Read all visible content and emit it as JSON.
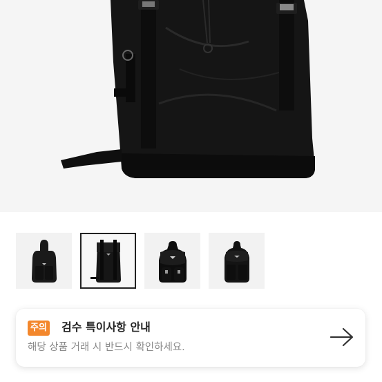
{
  "product": {
    "main_image": "black-nylon-backpack-image",
    "thumbnails": [
      {
        "image": "black-backpack-front-thumbnail",
        "selected": false
      },
      {
        "image": "black-flap-backpack-thumbnail",
        "selected": true
      },
      {
        "image": "black-leather-trim-backpack-thumbnail",
        "selected": false
      },
      {
        "image": "black-nylon-pocket-backpack-thumbnail",
        "selected": false
      }
    ]
  },
  "notice": {
    "badge": "주의",
    "title": "검수 특이사항 안내",
    "subtitle": "해당 상품 거래 시 반드시 확인하세요.",
    "arrow_icon": "arrow-right-icon"
  },
  "colors": {
    "badge_bg": "#f3872c",
    "hero_bg": "#f5f5f5",
    "title_text": "#222222",
    "subtitle_text": "#8a8a8a"
  }
}
